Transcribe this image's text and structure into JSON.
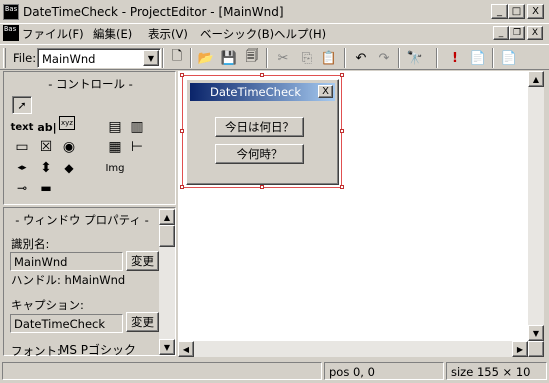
{
  "window": {
    "title": "DateTimeCheck - ProjectEditor - [MainWnd]",
    "app_icon_text": "Bas",
    "minimize": "_",
    "maximize": "□",
    "close": "X"
  },
  "menu": {
    "items": [
      {
        "label": "ファイル(F)"
      },
      {
        "label": "編集(E)"
      },
      {
        "label": "表示(V)"
      },
      {
        "label": "ベーシック(B)"
      },
      {
        "label": "ヘルプ(H)"
      }
    ],
    "mdi_minimize": "_",
    "mdi_restore": "❐",
    "mdi_close": "X"
  },
  "toolbar": {
    "file_label": "File:",
    "file_value": "MainWnd",
    "buttons": [
      {
        "name": "new-file-icon",
        "glyph": "🗋"
      },
      {
        "name": "open-folder-icon",
        "glyph": "📂"
      },
      {
        "name": "save-icon",
        "glyph": "💾"
      },
      {
        "name": "save-all-icon",
        "glyph": "🗐"
      },
      {
        "name": "cut-icon",
        "glyph": "✂"
      },
      {
        "name": "copy-icon",
        "glyph": "⎘"
      },
      {
        "name": "paste-icon",
        "glyph": "📋"
      },
      {
        "name": "undo-icon",
        "glyph": "↶"
      },
      {
        "name": "redo-icon",
        "glyph": "↷"
      },
      {
        "name": "find-icon",
        "glyph": "🔭"
      },
      {
        "name": "run-icon",
        "glyph": "!"
      },
      {
        "name": "compile-icon",
        "glyph": "📄"
      },
      {
        "name": "build-icon",
        "glyph": "📄"
      }
    ]
  },
  "controls_panel": {
    "header": "- コントロール -",
    "tools": [
      {
        "name": "pointer-tool-icon",
        "glyph": "➚"
      },
      {
        "name": "text-tool-icon",
        "glyph": "text"
      },
      {
        "name": "edit-tool-icon",
        "glyph": "ab|"
      },
      {
        "name": "groupbox-tool-icon",
        "glyph": "xyz"
      },
      {
        "name": "listview-tool-icon",
        "glyph": "▤"
      },
      {
        "name": "tab-tool-icon",
        "glyph": "▥"
      },
      {
        "name": "button-tool-icon",
        "glyph": "▭"
      },
      {
        "name": "checkbox-tool-icon",
        "glyph": "☒"
      },
      {
        "name": "radio-tool-icon",
        "glyph": "◉"
      },
      {
        "name": "grid-tool-icon",
        "glyph": "▦"
      },
      {
        "name": "tree-tool-icon",
        "glyph": "⊢"
      },
      {
        "name": "hscroll-tool-icon",
        "glyph": "◂▸"
      },
      {
        "name": "vscroll-tool-icon",
        "glyph": "⬍"
      },
      {
        "name": "spin-tool-icon",
        "glyph": "◆"
      },
      {
        "name": "image-tool-icon",
        "glyph": "Img"
      },
      {
        "name": "slider-tool-icon",
        "glyph": "⊸"
      },
      {
        "name": "progress-tool-icon",
        "glyph": "▬"
      }
    ]
  },
  "property_panel": {
    "header": "- ウィンドウ プロパティ -",
    "id_label": "識別名:",
    "id_value": "MainWnd",
    "change_label": "変更",
    "handle_label": "ハンドル: hMainWnd",
    "caption_label": "キャプション:",
    "caption_value": "DateTimeCheck",
    "font_label": "フォント:",
    "font_value": "MS Pゴシック"
  },
  "form": {
    "caption": "DateTimeCheck",
    "close": "X",
    "buttons": [
      {
        "label": "今日は何日？"
      },
      {
        "label": "今何時？"
      }
    ]
  },
  "status": {
    "pos": "pos 0, 0",
    "size": "size 155 × 10"
  }
}
